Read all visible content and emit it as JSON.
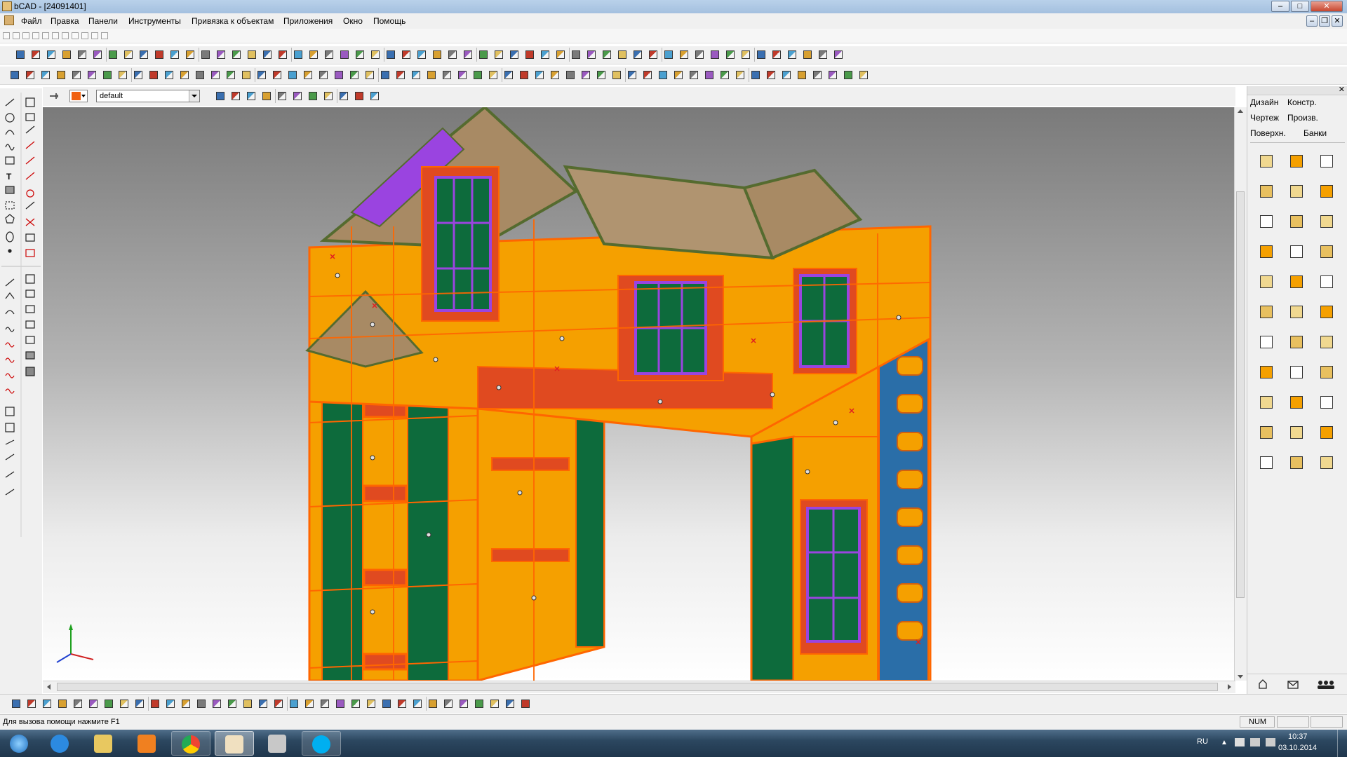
{
  "window": {
    "title": "bCAD - [24091401]",
    "controls": [
      "–",
      "□",
      "✕"
    ],
    "doc_controls": [
      "–",
      "❐",
      "✕"
    ]
  },
  "menu": {
    "items": [
      "Файл",
      "Правка",
      "Панели",
      "Инструменты",
      "Привязка к объектам",
      "Приложения",
      "Окно",
      "Помощь"
    ]
  },
  "toolbar3": {
    "layer_value": "default"
  },
  "right_panel": {
    "tabs_row1": [
      "Дизайн",
      "Констр."
    ],
    "tabs_row2": [
      "Чертеж",
      "Произв."
    ],
    "tabs_row3": [
      "Поверхн.",
      "Банки"
    ]
  },
  "status": {
    "help_text": "Для вызова помощи нажмите F1",
    "num": "NUM"
  },
  "taskbar": {
    "lang": "RU",
    "time": "10:37",
    "date": "03.10.2014"
  },
  "colors": {
    "orange": "#f5a000",
    "green": "#0d6b3c",
    "red": "#e04a20",
    "purple": "#9a44e0",
    "blue": "#2a6ea8",
    "roof": "#a88a64"
  }
}
